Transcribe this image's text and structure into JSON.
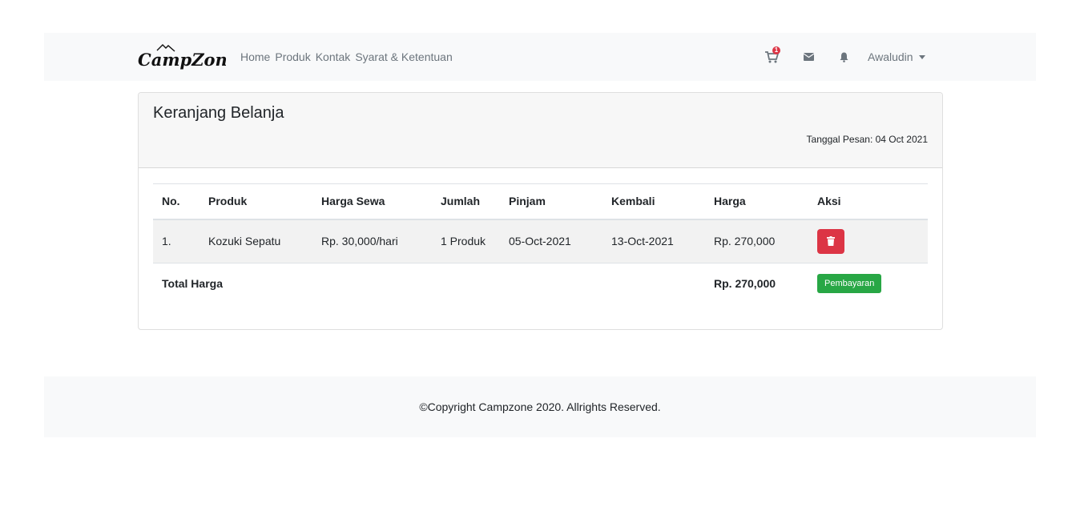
{
  "brand": {
    "logo_text": "CampZone"
  },
  "nav": {
    "links": [
      "Home",
      "Produk",
      "Kontak",
      "Syarat & Ketentuan"
    ],
    "cart_icon": "shopping-cart-icon",
    "cart_badge": "1",
    "mail_icon": "envelope-icon",
    "bell_icon": "bell-icon",
    "user_name": "Awaludin"
  },
  "cart": {
    "title": "Keranjang Belanja",
    "order_date": "Tanggal Pesan: 04 Oct 2021",
    "columns": [
      "No.",
      "Produk",
      "Harga Sewa",
      "Jumlah",
      "Pinjam",
      "Kembali",
      "Harga",
      "Aksi"
    ],
    "rows": [
      {
        "no": "1.",
        "produk": "Kozuki Sepatu",
        "harga_sewa": "Rp. 30,000/hari",
        "jumlah": "1 Produk",
        "pinjam": "05-Oct-2021",
        "kembali": "13-Oct-2021",
        "harga": "Rp. 270,000",
        "action_icon": "trash-icon"
      }
    ],
    "total_label": "Total Harga",
    "total_value": "Rp. 270,000",
    "pay_button": "Pembayaran"
  },
  "footer": {
    "text": "©Copyright Campzone 2020. Allrights Reserved."
  },
  "colors": {
    "navbar_bg": "#f8f9fa",
    "danger": "#dc3545",
    "success": "#28a745",
    "muted": "#6c757d"
  }
}
